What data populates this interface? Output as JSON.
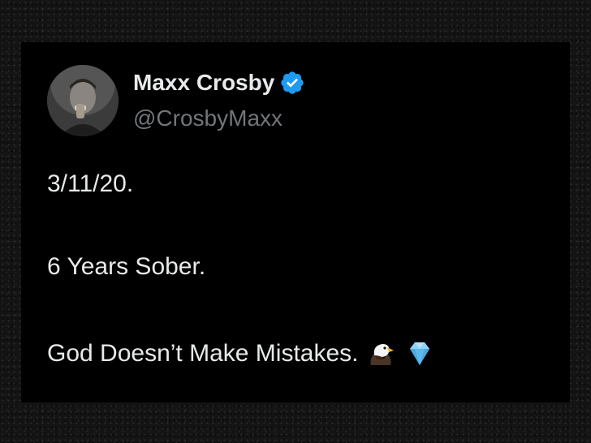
{
  "tweet": {
    "author": {
      "display_name": "Maxx Crosby",
      "handle": "@CrosbyMaxx",
      "verified": true,
      "avatar_icon": "profile-photo-avatar",
      "verified_icon": "verified-badge-icon"
    },
    "text_lines": [
      "3/11/20.",
      "6 Years Sober.",
      "God Doesn’t Make Mistakes."
    ],
    "emojis": [
      {
        "name": "eagle-emoji",
        "glyph": "🦅"
      },
      {
        "name": "gem-emoji",
        "glyph": "💎"
      }
    ]
  },
  "colors": {
    "card_background": "#000000",
    "text_primary": "#e7e9ea",
    "text_secondary": "#71767b",
    "verified_blue": "#1d9bf0",
    "outer_background": "#141414"
  }
}
